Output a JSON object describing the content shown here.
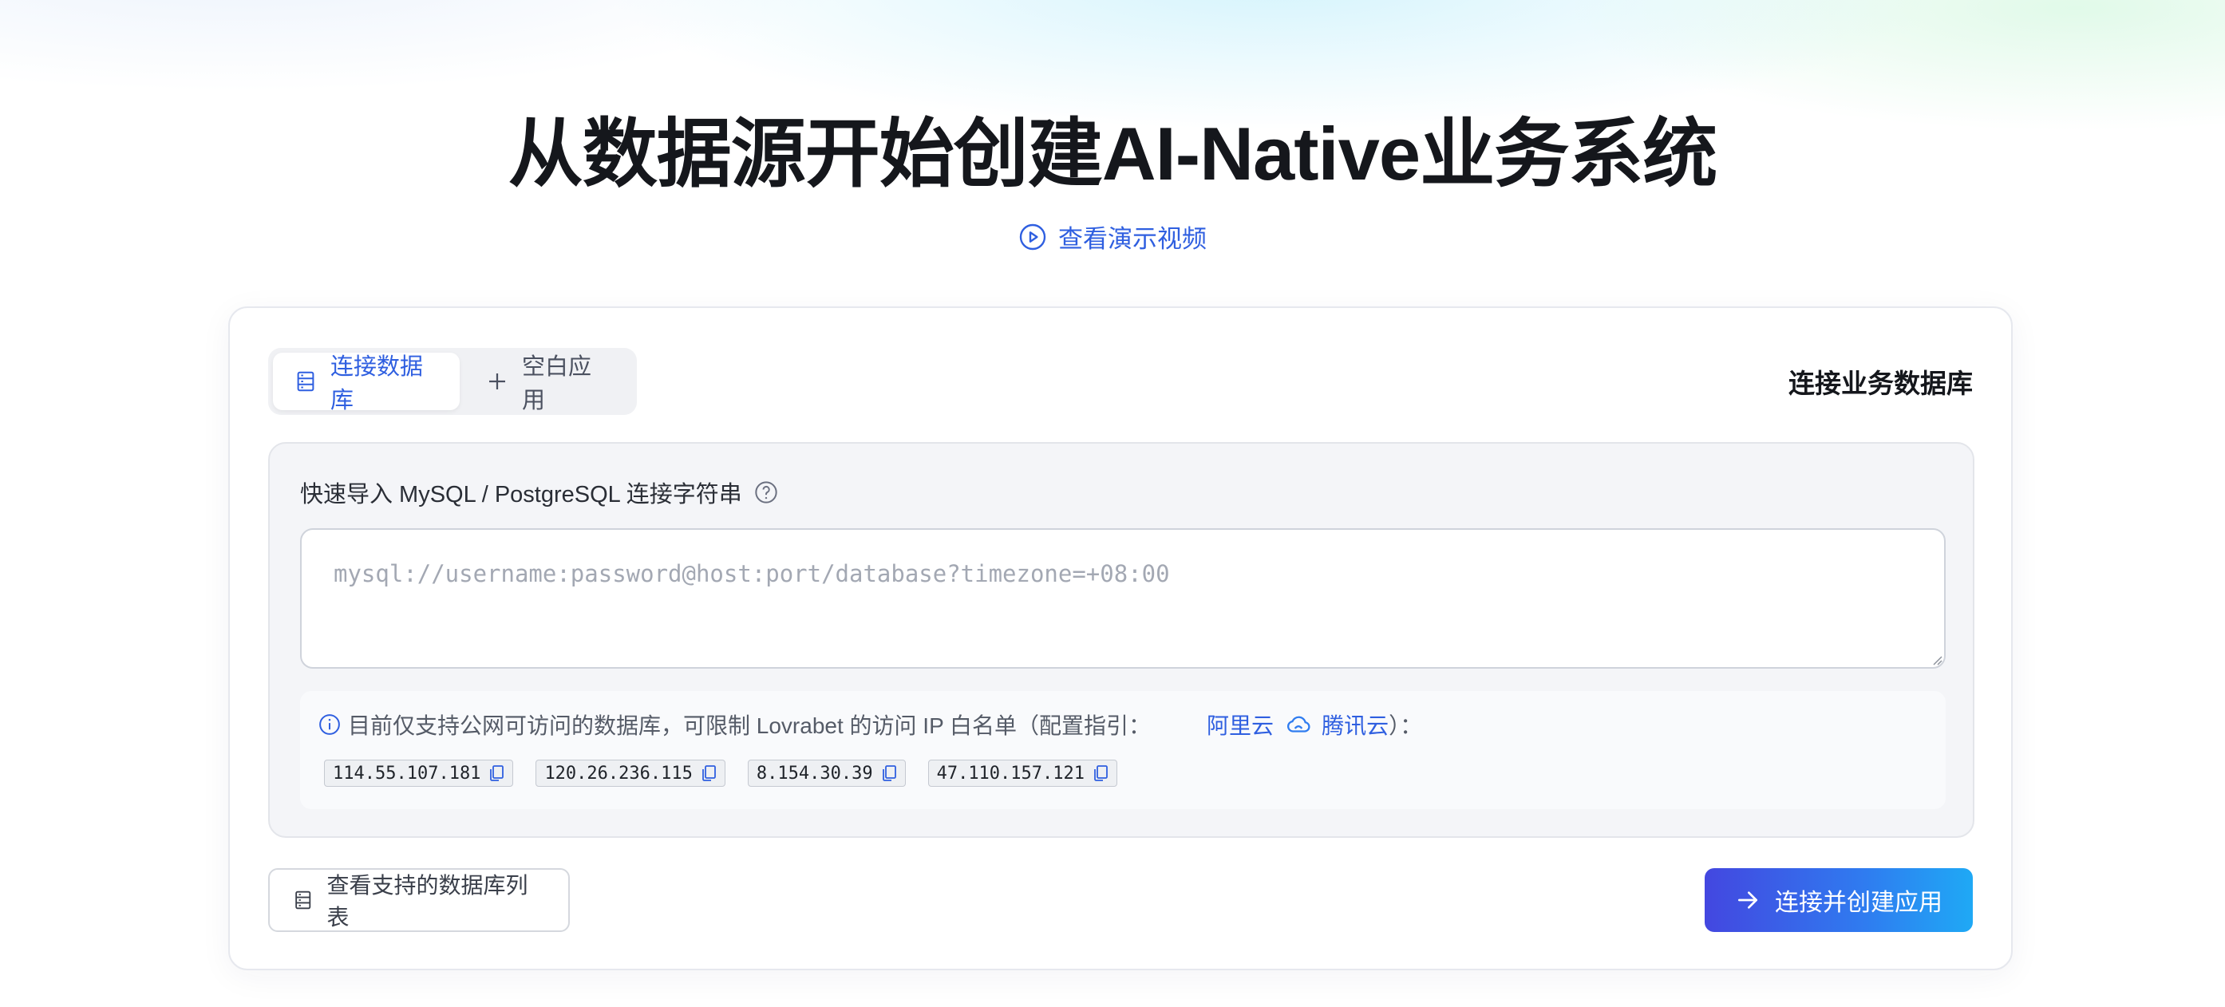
{
  "hero": {
    "title": "从数据源开始创建AI-Native业务系统",
    "demo_link": "查看演示视频"
  },
  "tabs": [
    {
      "label": "连接数据库",
      "icon": "database-icon",
      "active": true
    },
    {
      "label": "空白应用",
      "icon": "plus-icon",
      "active": false
    }
  ],
  "card": {
    "heading": "连接业务数据库"
  },
  "import": {
    "label": "快速导入 MySQL / PostgreSQL 连接字符串",
    "placeholder": "mysql://username:password@host:port/database?timezone=+08:00",
    "value": ""
  },
  "notice": {
    "text": "目前仅支持公网可访问的数据库，可限制 Lovrabet 的访问 IP 白名单（配置指引：",
    "aliyun": "阿里云",
    "tencent": "腾讯云",
    "suffix": "）："
  },
  "ips": [
    "114.55.107.181",
    "120.26.236.115",
    "8.154.30.39",
    "47.110.157.121"
  ],
  "actions": {
    "list_label": "查看支持的数据库列表",
    "connect_label": "连接并创建应用"
  },
  "colors": {
    "accent": "#2f5fe0",
    "button_gradient_start": "#4347e0",
    "button_gradient_end": "#1fa9f5"
  }
}
